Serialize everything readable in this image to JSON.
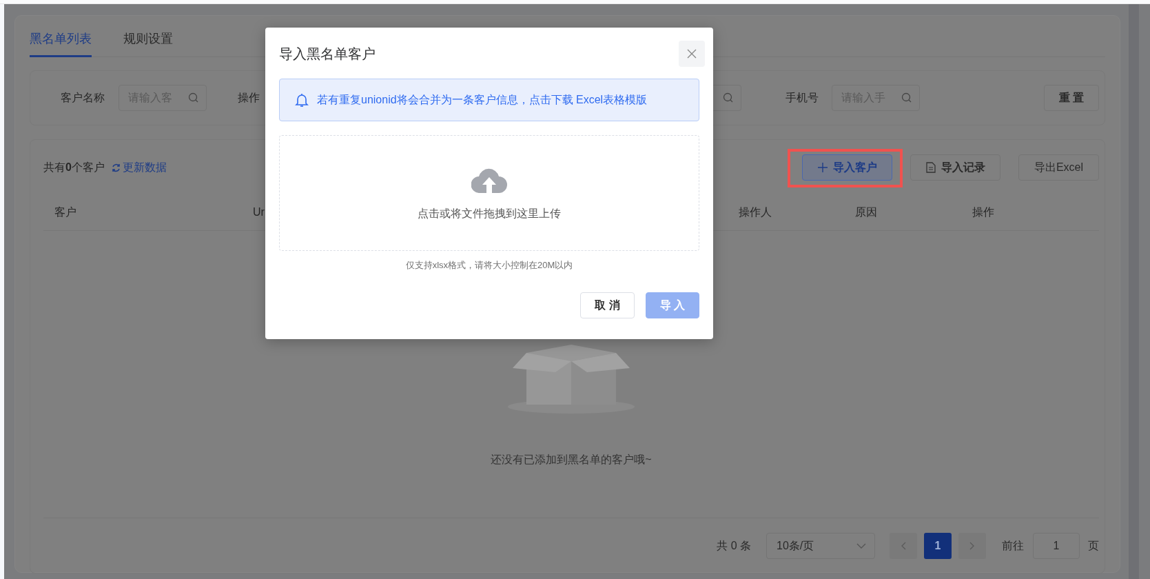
{
  "tabs": [
    {
      "label": "黑名单列表",
      "selected": true
    },
    {
      "label": "规则设置",
      "selected": false
    }
  ],
  "filters": {
    "name_label": "客户名称",
    "name_placeholder": "请输入客",
    "operator_label": "操作",
    "phone_label": "手机号",
    "phone_placeholder": "请输入手"
  },
  "reset_button": "重 置",
  "summary": "共有**0**个客户",
  "refresh_link": "更新数据",
  "actions": [
    {
      "label": "导入客户",
      "kind": "add",
      "highlighted": true
    },
    {
      "label": "导入记录",
      "kind": "record",
      "highlighted": false
    },
    {
      "label": "导出Excel",
      "kind": "plain",
      "highlighted": false
    }
  ],
  "table": {
    "columns": [
      "客户",
      "Ur",
      "操作人",
      "原因",
      "操作"
    ],
    "empty_text": "还没有已添加到黑名单的客户哦~"
  },
  "pagination": {
    "total": "共 0 条",
    "page_size": "10条/页",
    "pages": [
      {
        "label": "1",
        "selected": true
      }
    ],
    "goto_label": "前往",
    "goto_value": "1",
    "page_unit": "页"
  },
  "dialog": {
    "title": "导入黑名单客户",
    "notice": "若有重复unionid将会合并为一条客户信息，点击下载 Excel表格模版",
    "upload_text": "点击或将文件拖拽到这里上传",
    "hint": "仅支持xlsx格式，请将大小控制在20M以内",
    "buttons": [
      {
        "label": "取 消",
        "kind": "cancel",
        "disabled": false
      },
      {
        "label": "导 入",
        "kind": "confirm",
        "disabled": true
      }
    ]
  }
}
